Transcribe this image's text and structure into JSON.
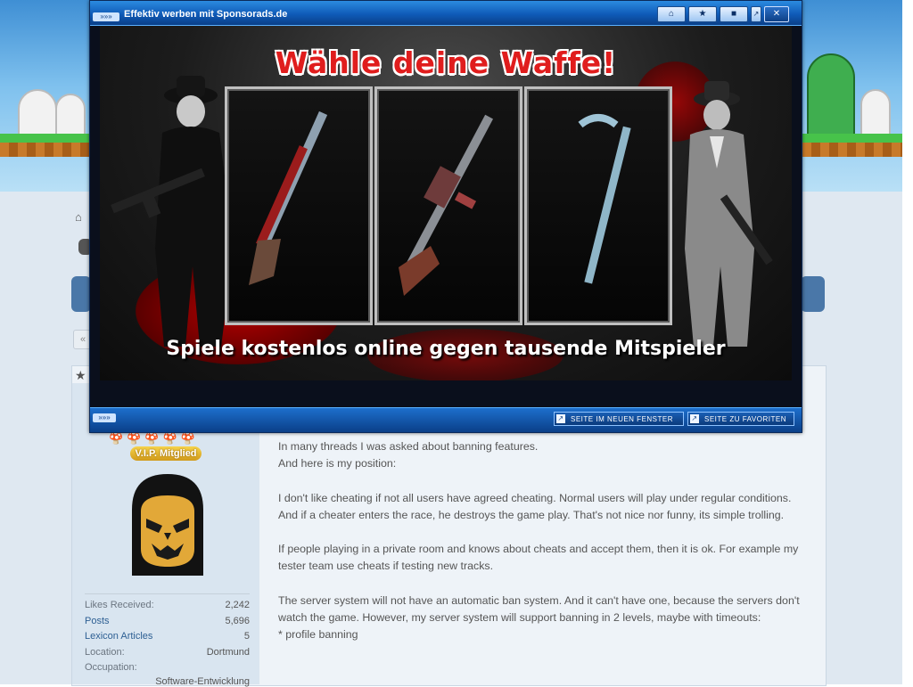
{
  "popup": {
    "title": "Effektiv werben mit Sponsorads.de",
    "ad_headline": "Wähle deine Waffe!",
    "ad_subline": "Spiele kostenlos online gegen tausende Mitspieler",
    "btn_new_window": "SEITE IM NEUEN FENSTER",
    "btn_favorites": "SEITE ZU FAVORITEN"
  },
  "user": {
    "rank": "V.I.P. Mitglied",
    "stats": {
      "likes_label": "Likes Received:",
      "likes_value": "2,242",
      "posts_label": "Posts",
      "posts_value": "5,696",
      "lexicon_label": "Lexicon Articles",
      "lexicon_value": "5",
      "location_label": "Location:",
      "location_value": "Dortmund",
      "occupation_label": "Occupation:",
      "occupation_value": "Software-Entwicklung"
    }
  },
  "post": {
    "p1": "In many threads I was asked about banning features.",
    "p2": "And here is my position:",
    "p3": "I don't like cheating if not all users have agreed cheating. Normal users will play under regular conditions. And if a cheater enters the race, he destroys the game play. That's not nice nor funny, its simple trolling.",
    "p4": "If people playing in a private room and knows about cheats and accept them, then it is ok. For example my tester team use cheats if testing new tracks.",
    "p5": "The server system will not have an automatic ban system. And it can't have one, because the servers don't watch the game. However, my server system will support banning in 2 levels, maybe with timeouts:",
    "p6": "* profile banning"
  },
  "colors": {
    "popup_blue": "#0f5bb8",
    "headline_red": "#e01d1d",
    "link_blue": "#2d5f93"
  }
}
